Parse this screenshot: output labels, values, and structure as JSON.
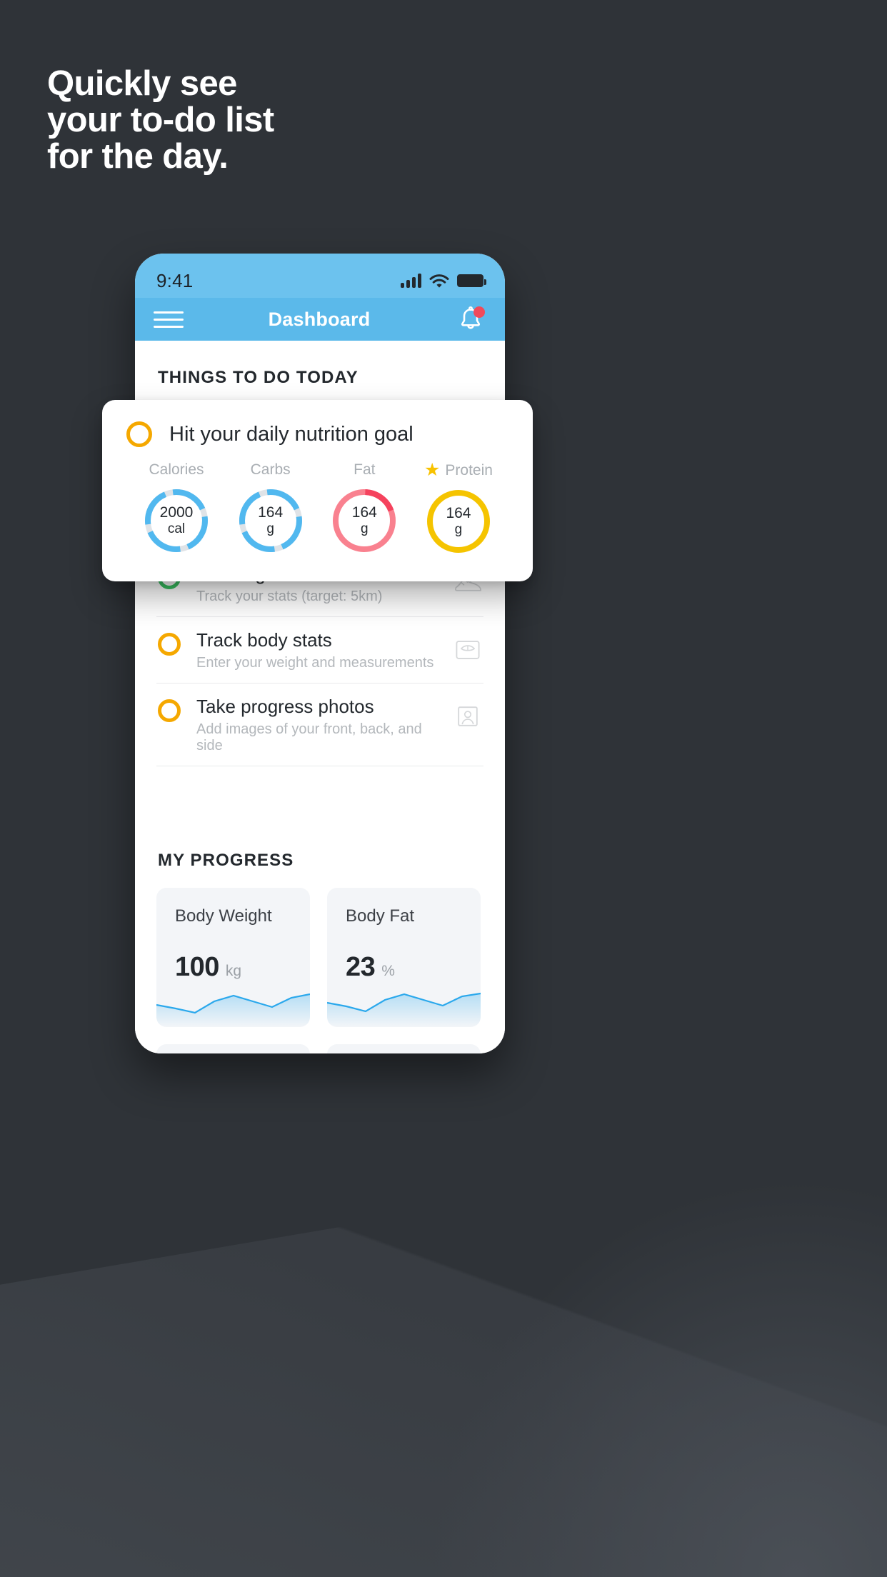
{
  "headline": {
    "line1": "Quickly see",
    "line2": "your to-do list",
    "line3": "for the day."
  },
  "colors": {
    "background": "#2f3338",
    "statusbar": "#6cc2ee",
    "appbar": "#5bb9ea",
    "accent_blue": "#51b8ef",
    "accent_yellow": "#f5a800",
    "accent_green": "#3ac162",
    "accent_red": "#f9818f",
    "accent_red_dark": "#f5425d",
    "accent_gold": "#f5c400",
    "notification_dot": "#f04a5a"
  },
  "phone": {
    "statusbar": {
      "time": "9:41",
      "signal_icon": "cellular-signal-icon",
      "wifi_icon": "wifi-icon",
      "battery_icon": "battery-full-icon"
    },
    "appbar": {
      "menu_icon": "hamburger-menu-icon",
      "title": "Dashboard",
      "notifications_icon": "bell-icon",
      "has_notification_badge": true
    },
    "things_to_do": {
      "heading": "THINGS TO DO TODAY",
      "items": [
        {
          "title": "Running",
          "subtitle": "Track your stats (target: 5km)",
          "checkbox_color": "#3ac162",
          "icon": "running-shoe-icon"
        },
        {
          "title": "Track body stats",
          "subtitle": "Enter your weight and measurements",
          "checkbox_color": "#f5a800",
          "icon": "weight-scale-icon"
        },
        {
          "title": "Take progress photos",
          "subtitle": "Add images of your front, back, and side",
          "checkbox_color": "#f5a800",
          "icon": "progress-photo-icon"
        }
      ]
    },
    "my_progress": {
      "heading": "MY PROGRESS",
      "cards": [
        {
          "title": "Body Weight",
          "value": "100",
          "unit": "kg"
        },
        {
          "title": "Body Fat",
          "value": "23",
          "unit": "%"
        }
      ]
    }
  },
  "nutrition_card": {
    "checkbox_color": "#f5a800",
    "title": "Hit your daily nutrition goal",
    "macros": [
      {
        "label": "Calories",
        "value": "2000",
        "unit": "cal",
        "ring_color": "#51b8ef",
        "track_color": "#dfe3e7",
        "starred": false,
        "segments": 4
      },
      {
        "label": "Carbs",
        "value": "164",
        "unit": "g",
        "ring_color": "#51b8ef",
        "track_color": "#dfe3e7",
        "starred": false,
        "segments": 4
      },
      {
        "label": "Fat",
        "value": "164",
        "unit": "g",
        "ring_color": "#f9818f",
        "track_color": "#f5425d",
        "starred": false,
        "segments": 1
      },
      {
        "label": "Protein",
        "value": "164",
        "unit": "g",
        "ring_color": "#f5c400",
        "track_color": "#f5c400",
        "starred": true,
        "segments": 0
      }
    ],
    "star_icon": "star-icon"
  },
  "chart_data": [
    {
      "type": "area",
      "title": "Body Weight",
      "ylabel": "kg",
      "x": [
        0,
        1,
        2,
        3,
        4,
        5,
        6,
        7,
        8
      ],
      "values": [
        52,
        44,
        34,
        58,
        72,
        58,
        45,
        62,
        74,
        70
      ],
      "ylim": [
        0,
        100
      ],
      "grid": false,
      "legend": "none"
    },
    {
      "type": "area",
      "title": "Body Fat",
      "ylabel": "%",
      "x": [
        0,
        1,
        2,
        3,
        4,
        5,
        6,
        7,
        8
      ],
      "values": [
        56,
        46,
        36,
        60,
        74,
        60,
        48,
        64,
        76,
        72
      ],
      "ylim": [
        0,
        100
      ],
      "grid": false,
      "legend": "none"
    }
  ]
}
